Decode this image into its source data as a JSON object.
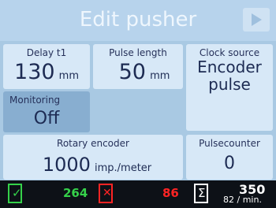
{
  "title": "Edit pusher",
  "delay": {
    "label": "Delay t1",
    "value": "130",
    "unit": "mm"
  },
  "pulse_length": {
    "label": "Pulse length",
    "value": "50",
    "unit": "mm"
  },
  "clock_source": {
    "label": "Clock source",
    "line1": "Encoder",
    "line2": "pulse"
  },
  "monitoring": {
    "label": "Monitoring",
    "value": "Off"
  },
  "rotary_encoder": {
    "label": "Rotary encoder",
    "value": "1000",
    "unit": "imp./meter"
  },
  "pulsecounter": {
    "label": "Pulsecounter",
    "value": "0"
  },
  "status": {
    "good_count": "264",
    "reject_count": "86",
    "total_count": "350",
    "rate": "82 / min."
  },
  "colors": {
    "good": "#35d14a",
    "reject": "#ff2424",
    "panel_bg": "#a9c9e3",
    "tile_bg": "#d7e8f7"
  }
}
